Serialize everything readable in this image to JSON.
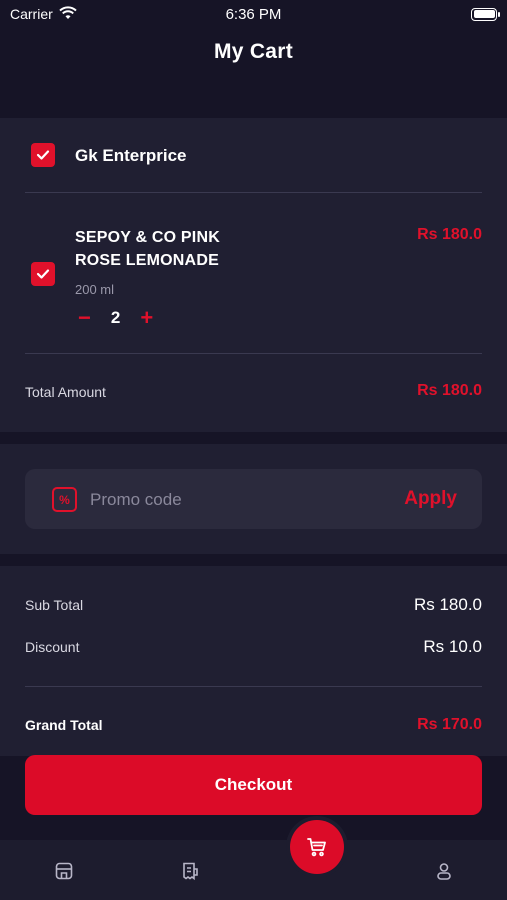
{
  "status_bar": {
    "carrier": "Carrier",
    "time": "6:36 PM"
  },
  "page": {
    "title": "My Cart"
  },
  "store": {
    "name": "Gk Enterprice",
    "item": {
      "name_line1": "SEPOY & CO PINK",
      "name_line2": "ROSE LEMONADE",
      "price": "Rs 180.0",
      "size": "200 ml",
      "quantity": "2",
      "minus": "−",
      "plus": "+"
    },
    "total_label": "Total Amount",
    "total_value": "Rs 180.0"
  },
  "promo": {
    "icon": "%",
    "placeholder": "Promo code",
    "apply_label": "Apply"
  },
  "summary": {
    "subtotal_label": "Sub Total",
    "subtotal_value": "Rs 180.0",
    "discount_label": "Discount",
    "discount_value": "Rs 10.0",
    "grand_label": "Grand Total",
    "grand_value": "Rs 170.0"
  },
  "checkout": {
    "label": "Checkout"
  },
  "tab_bar": {
    "icons": [
      "store-icon",
      "receipt-icon",
      "cart-icon",
      "profile-icon"
    ]
  },
  "colors": {
    "accent": "#e0112b",
    "background": "#161426",
    "card": "#201f32"
  }
}
